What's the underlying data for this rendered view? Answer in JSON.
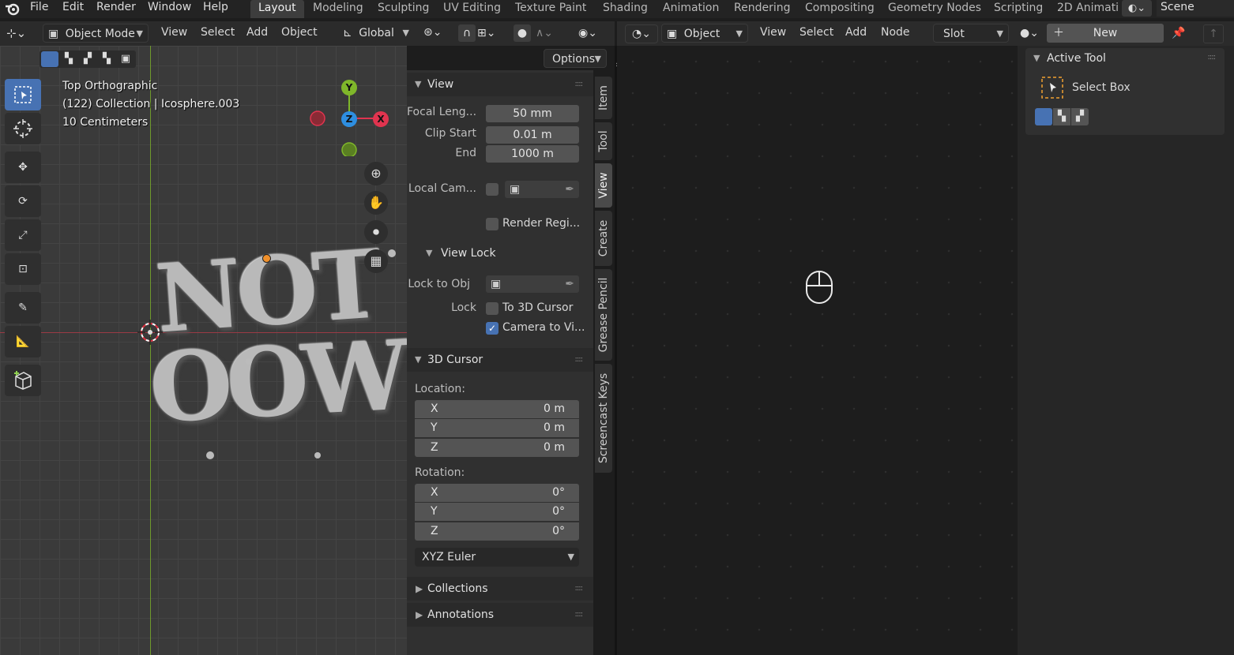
{
  "menubar": {
    "items": [
      "File",
      "Edit",
      "Render",
      "Window",
      "Help"
    ],
    "workspaces": [
      "Layout",
      "Modeling",
      "Sculpting",
      "UV Editing",
      "Texture Paint",
      "Shading",
      "Animation",
      "Rendering",
      "Compositing",
      "Geometry Nodes",
      "Scripting",
      "2D Animati"
    ],
    "active_workspace": "Layout",
    "scene_label": "Scene"
  },
  "viewport_header": {
    "mode": "Object Mode",
    "menus": [
      "View",
      "Select",
      "Add",
      "Object"
    ],
    "transform_orientation": "Global",
    "options_label": "Options"
  },
  "viewport": {
    "view_name": "Top Orthographic",
    "collection_line": "(122) Collection | Icosphere.003",
    "scale_line": "10 Centimeters",
    "gizmo": {
      "y": "Y",
      "z": "Z",
      "x": "X"
    },
    "object_text": {
      "line1": "NOT",
      "line2": "OOW"
    }
  },
  "npanel": {
    "view": {
      "title": "View",
      "focal_length_label": "Focal Leng...",
      "focal_length": "50 mm",
      "clip_start_label": "Clip Start",
      "clip_start": "0.01 m",
      "clip_end_label": "End",
      "clip_end": "1000 m",
      "local_cam_label": "Local Cam...",
      "render_region_label": "Render Regi..."
    },
    "view_lock": {
      "title": "View Lock",
      "lock_to_obj_label": "Lock to Obj",
      "lock_label": "Lock",
      "to_3d_cursor_label": "To 3D Cursor",
      "to_3d_cursor_checked": false,
      "camera_to_view_label": "Camera to Vi...",
      "camera_to_view_checked": true
    },
    "cursor": {
      "title": "3D Cursor",
      "location_label": "Location:",
      "location": {
        "x": "0 m",
        "y": "0 m",
        "z": "0 m"
      },
      "rotation_label": "Rotation:",
      "rotation": {
        "x": "0°",
        "y": "0°",
        "z": "0°"
      },
      "rotation_mode": "XYZ Euler"
    },
    "collections_title": "Collections",
    "annotations_title": "Annotations",
    "axes": {
      "x": "X",
      "y": "Y",
      "z": "Z"
    }
  },
  "vertical_tabs": [
    "Item",
    "Tool",
    "View",
    "Create",
    "Grease Pencil",
    "Screencast Keys"
  ],
  "active_vertical_tab": "View",
  "node_header": {
    "type": "Object",
    "menus": [
      "View",
      "Select",
      "Add",
      "Node"
    ],
    "slot": "Slot",
    "new_label": "New"
  },
  "side_panel": {
    "title": "Active Tool",
    "tool_name": "Select Box"
  },
  "colors": {
    "accent_blue": "#4772b3",
    "axis_x": "#e0344f",
    "axis_y": "#7fb72a",
    "axis_z": "#2e8ee0"
  }
}
